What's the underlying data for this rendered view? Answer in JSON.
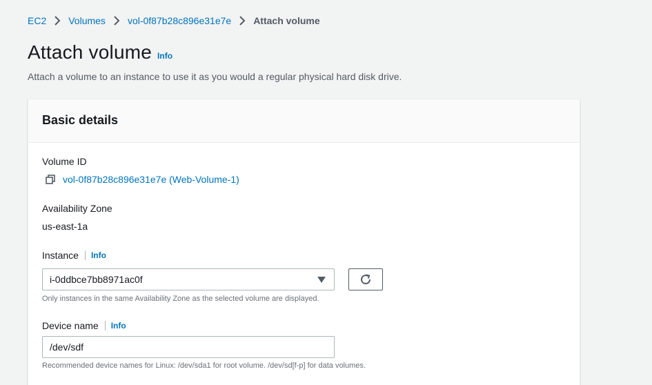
{
  "breadcrumb": {
    "items": [
      "EC2",
      "Volumes",
      "vol-0f87b28c896e31e7e"
    ],
    "current": "Attach volume"
  },
  "header": {
    "title": "Attach volume",
    "info": "Info",
    "description": "Attach a volume to an instance to use it as you would a regular physical hard disk drive."
  },
  "section": {
    "title": "Basic details",
    "volume_id": {
      "label": "Volume ID",
      "value": "vol-0f87b28c896e31e7e (Web-Volume-1)",
      "icon": "copy-icon"
    },
    "availability_zone": {
      "label": "Availability Zone",
      "value": "us-east-1a"
    },
    "instance": {
      "label": "Instance",
      "info": "Info",
      "selected": "i-0ddbce7bb8971ac0f",
      "hint": "Only instances in the same Availability Zone as the selected volume are displayed.",
      "refresh_icon": "refresh-icon"
    },
    "device_name": {
      "label": "Device name",
      "info": "Info",
      "value": "/dev/sdf",
      "hint": "Recommended device names for Linux: /dev/sda1 for root volume. /dev/sd[f-p] for data volumes."
    }
  },
  "colors": {
    "link": "#0073bb",
    "background": "#f2f3f3",
    "text": "#16191f",
    "secondary_text": "#545b64"
  }
}
